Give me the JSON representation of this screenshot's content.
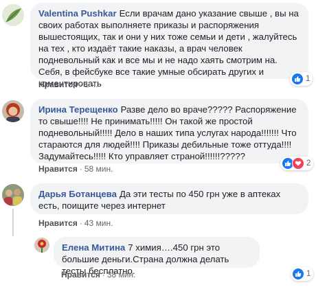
{
  "comments": [
    {
      "author": "Valentina Pushkar",
      "text": "Если врачам дано указание свыше , вы на своих работах выполняете приказы и распоряжения вышестоящих, так и они у них тоже семьи и дети , жалуйтесь на тех , кто издаёт такие наказы, а врач человек подневольный как и все мы и не надо хаять смотрим на. Себя, в фейсбуке все такие умные обсирать других и коментировать",
      "like_label": "Нравится",
      "separator": "·",
      "time": "1 ч.",
      "reaction_count": "1",
      "avatar_icon": "leaf-avatar"
    },
    {
      "author": "Ирина Терещенко",
      "text": "Разве дело во враче????? Распоряжение то свыше!!!! Не принимать!!!!! Он такой же простой подневольный!!!!! Дело в наших типа услугах народа!!!!!!! Что стараются для людей!!!! Приказы дебильные тоже оттуда!!!! Задумайтесь!!!!! Кто управляет страной!!!!!!?????",
      "like_label": "Нравится",
      "separator": "·",
      "time": "58 мин.",
      "reaction_count": "2",
      "avatar_icon": "woman-red-hair-avatar"
    },
    {
      "author": "Дарья Ботанцева",
      "text": "Да эти тесты по 450 грн уже в аптеках есть, поищите через интернет",
      "like_label": "Нравится",
      "separator": "·",
      "time": "43 мин.",
      "avatar_icon": "group-photo-avatar"
    }
  ],
  "reply": {
    "author": "Елена Митина",
    "text": "7 химия….450 грн это большие деньги.Страна должна делать тесты бесплатно.",
    "like_label": "Нравится",
    "separator": "·",
    "time": "38 мин.",
    "reaction_count": "1",
    "avatar_icon": "red-flower-avatar"
  },
  "colors": {
    "author": "#385898",
    "bubble": "#f2f3f5",
    "like_reaction": "#1877f2",
    "love_reaction": "#f33e58"
  }
}
